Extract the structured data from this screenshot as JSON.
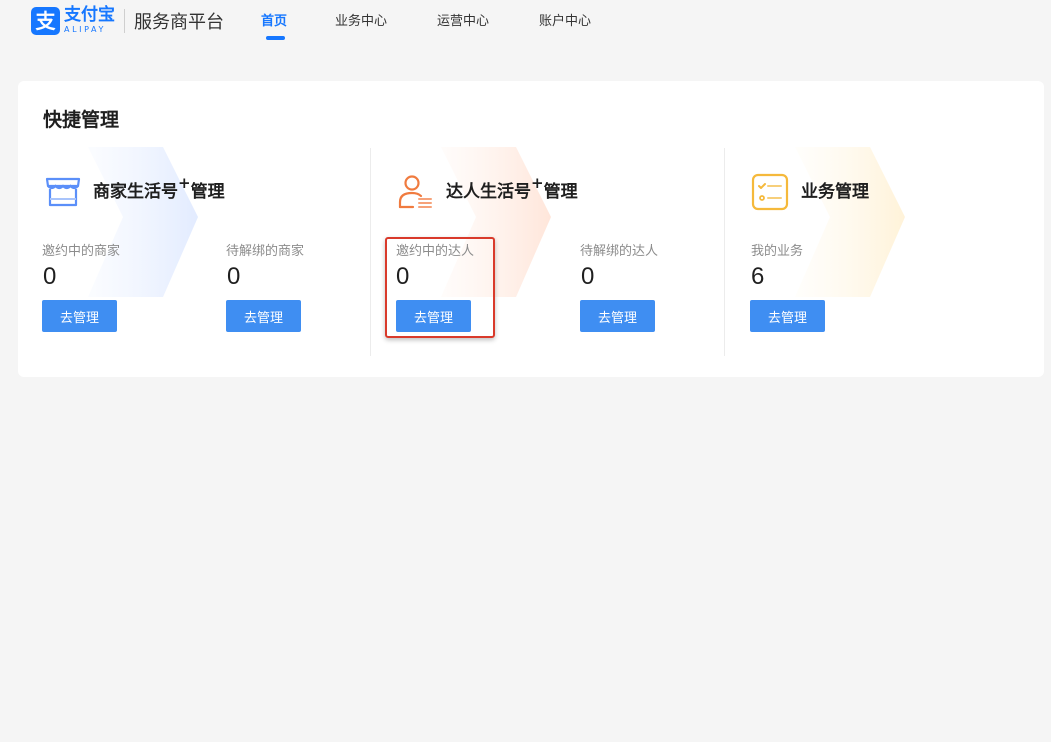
{
  "header": {
    "logo_mark": "支",
    "logo_cn": "支付宝",
    "logo_en": "ALIPAY",
    "platform_name": "服务商平台",
    "tabs": [
      {
        "label": "首页",
        "active": true
      },
      {
        "label": "业务中心",
        "active": false
      },
      {
        "label": "运营中心",
        "active": false
      },
      {
        "label": "账户中心",
        "active": false
      }
    ]
  },
  "quick_manage": {
    "title": "快捷管理",
    "sections": [
      {
        "title_prefix": "商家生活号",
        "title_sup": "+",
        "title_suffix": "管理",
        "icon": "store-icon",
        "stats": [
          {
            "label": "邀约中的商家",
            "value": "0",
            "button": "去管理"
          },
          {
            "label": "待解绑的商家",
            "value": "0",
            "button": "去管理"
          }
        ]
      },
      {
        "title_prefix": "达人生活号",
        "title_sup": "+",
        "title_suffix": "管理",
        "icon": "person-list-icon",
        "stats": [
          {
            "label": "邀约中的达人",
            "value": "0",
            "button": "去管理"
          },
          {
            "label": "待解绑的达人",
            "value": "0",
            "button": "去管理"
          }
        ]
      },
      {
        "title_prefix": "业务管理",
        "icon": "checklist-icon",
        "stats": [
          {
            "label": "我的业务",
            "value": "6",
            "button": "去管理"
          }
        ]
      }
    ]
  },
  "colors": {
    "brand": "#1677ff",
    "button": "#3f8ef2",
    "highlight": "#d93a2b",
    "store_icon": "#5b8ff9",
    "person_icon": "#f07b3f",
    "checklist_icon": "#f5b93b"
  }
}
